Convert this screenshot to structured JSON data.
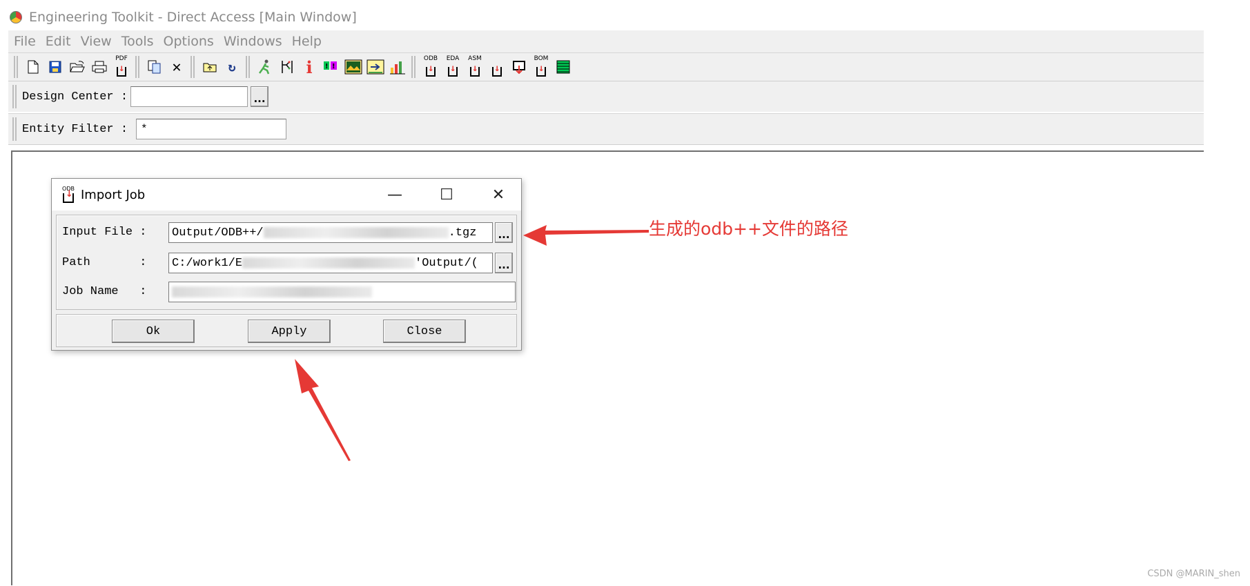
{
  "window": {
    "title": "Engineering Toolkit - Direct Access [Main Window]"
  },
  "menu": [
    "File",
    "Edit",
    "View",
    "Tools",
    "Options",
    "Windows",
    "Help"
  ],
  "toolbar": {
    "icons": {
      "new": "new-file-icon",
      "save": "save-icon",
      "open": "open-folder-icon",
      "print": "print-icon",
      "pdf_label": "PDF",
      "copy": "copy-icon",
      "delete": "delete-icon",
      "folder_up": "folder-up-icon",
      "refresh": "refresh-icon",
      "run": "run-icon",
      "tree": "tree-icon",
      "info": "info-icon",
      "flags": "flags-icon",
      "image": "image-icon",
      "export": "export-icon",
      "chart": "chart-icon",
      "odb_label": "ODB",
      "eda_label": "EDA",
      "asm_label": "ASM",
      "bom_label": "BOM",
      "list": "list-icon"
    }
  },
  "design_center": {
    "label": "Design Center :",
    "value": ""
  },
  "entity_filter": {
    "label": "Entity Filter :",
    "value": "*"
  },
  "dialog": {
    "title": "Import Job",
    "icon_label": "ODB",
    "minimize": "—",
    "maximize": "☐",
    "close_glyph": "✕",
    "input_file": {
      "label": "Input File :",
      "prefix": "Output/ODB++/",
      "suffix": ".tgz"
    },
    "path": {
      "label": "Path       :",
      "prefix": "C:/work1/E",
      "suffix": "'Output/("
    },
    "job_name": {
      "label": "Job Name   :"
    },
    "browse_label": "...",
    "buttons": {
      "ok": "Ok",
      "apply": "Apply",
      "close": "Close"
    }
  },
  "annotation": {
    "text": "生成的odb++文件的路径",
    "color": "#e53935"
  },
  "watermark": "CSDN @MARIN_shen"
}
